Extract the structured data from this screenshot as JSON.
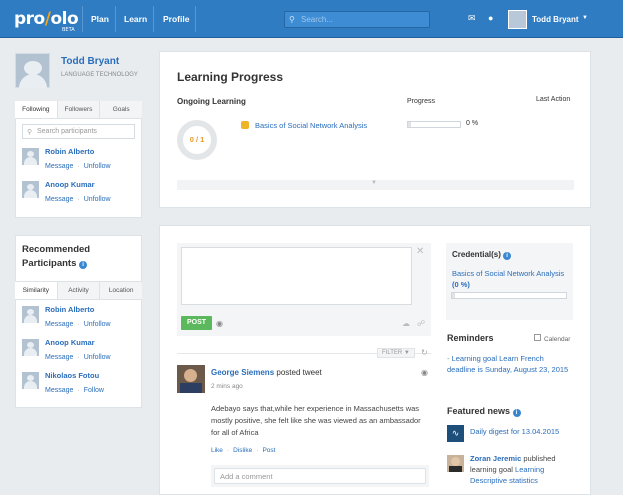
{
  "topbar": {
    "logo_pre": "pro",
    "logo_post": "olo",
    "logo_beta": "BETA",
    "nav": [
      "Plan",
      "Learn",
      "Profile"
    ],
    "search_placeholder": "Search...",
    "user_name": "Todd Bryant",
    "accent": "#2f7cc3"
  },
  "profile": {
    "name": "Todd Bryant",
    "subtitle": "LANGUAGE TECHNOLOGY"
  },
  "following": {
    "tabs": [
      "Following",
      "Followers",
      "Goals"
    ],
    "search_placeholder": "Search participants",
    "people": [
      {
        "name": "Robin Alberto",
        "action1": "Message",
        "action2": "Unfollow"
      },
      {
        "name": "Anoop Kumar",
        "action1": "Message",
        "action2": "Unfollow"
      }
    ]
  },
  "recommended": {
    "title": "Recommended Participants",
    "tabs": [
      "Similarity",
      "Activity",
      "Location"
    ],
    "people": [
      {
        "name": "Robin Alberto",
        "action1": "Message",
        "action2": "Unfollow"
      },
      {
        "name": "Anoop Kumar",
        "action1": "Message",
        "action2": "Unfollow"
      },
      {
        "name": "Nikolaos Fotou",
        "action1": "Message",
        "action2": "Follow"
      }
    ]
  },
  "learning": {
    "title": "Learning Progress",
    "col_ongoing": "Ongoing Learning",
    "col_progress": "Progress",
    "col_last": "Last Action",
    "ring_text": "0 / 1",
    "goal": "Basics of Social Network Analysis",
    "progress_pct": "0 %",
    "progress_value": 0
  },
  "composer": {
    "post_label": "POST"
  },
  "feed": {
    "filter_label": "FILTER",
    "post": {
      "author": "George Siemens",
      "verb": "posted tweet",
      "time": "2 mins ago",
      "body": "Adebayo says that,while her experience in Massachusetts was mostly positive, she felt like she was viewed as an ambassador for all of Africa",
      "like": "Like",
      "dislike": "Dislike",
      "post": "Post",
      "comment_placeholder": "Add a comment"
    }
  },
  "credentials": {
    "title": "Credential(s)",
    "name": "Basics of Social Network Analysis",
    "pct": "(0 %)",
    "value": 0
  },
  "reminders": {
    "title": "Reminders",
    "calendar": "Calendar",
    "text": "Learning goal Learn French deadline is Sunday, August 23, 2015"
  },
  "news": {
    "title": "Featured news",
    "item1": "Daily digest for 13.04.2015",
    "item2_author": "Zoran Jeremic",
    "item2_rest": "published learning goal",
    "item2_link": "Learning Descriptive statistics"
  }
}
